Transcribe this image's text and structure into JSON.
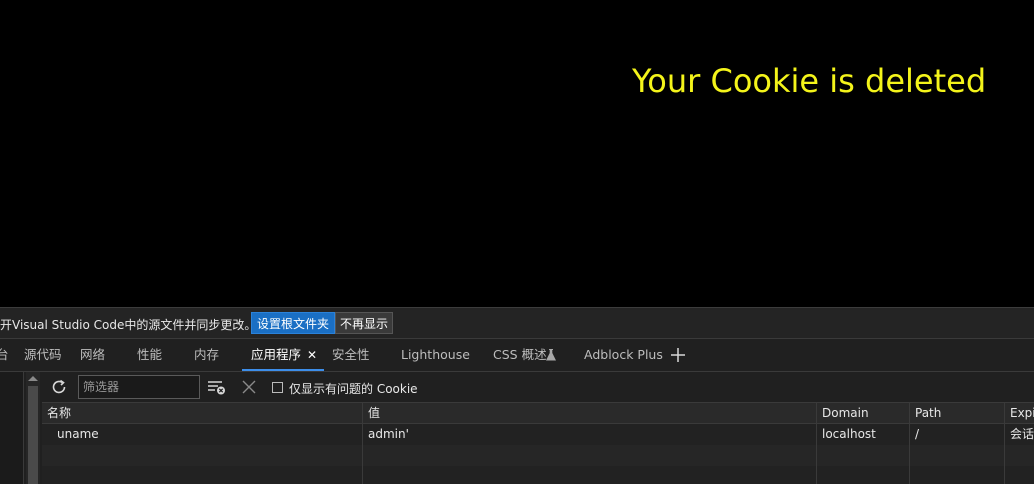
{
  "page": {
    "message": "Your Cookie is deleted",
    "message_color": "#f4f41a"
  },
  "infobar": {
    "text": "开Visual Studio Code中的源文件并同步更改。",
    "set_root_label": "设置根文件夹",
    "no_show_label": "不再显示"
  },
  "tabs": [
    {
      "label": "台"
    },
    {
      "label": "源代码"
    },
    {
      "label": "网络"
    },
    {
      "label": "性能"
    },
    {
      "label": "内存"
    },
    {
      "label": "应用程序",
      "active": true
    },
    {
      "label": "安全性"
    },
    {
      "label": "Lighthouse"
    },
    {
      "label": "CSS 概述"
    },
    {
      "label": "Adblock Plus"
    }
  ],
  "toolbar": {
    "filter_placeholder": "筛选器",
    "only_issues_label": "仅显示有问题的 Cookie"
  },
  "table": {
    "headers": [
      "名称",
      "值",
      "Domain",
      "Path",
      "Expires"
    ],
    "rows": [
      [
        "uname",
        "admin'",
        "localhost",
        "/",
        "会话"
      ]
    ]
  },
  "colors": {
    "accent": "#3d8eea",
    "primary_button": "#1a6fc4"
  }
}
